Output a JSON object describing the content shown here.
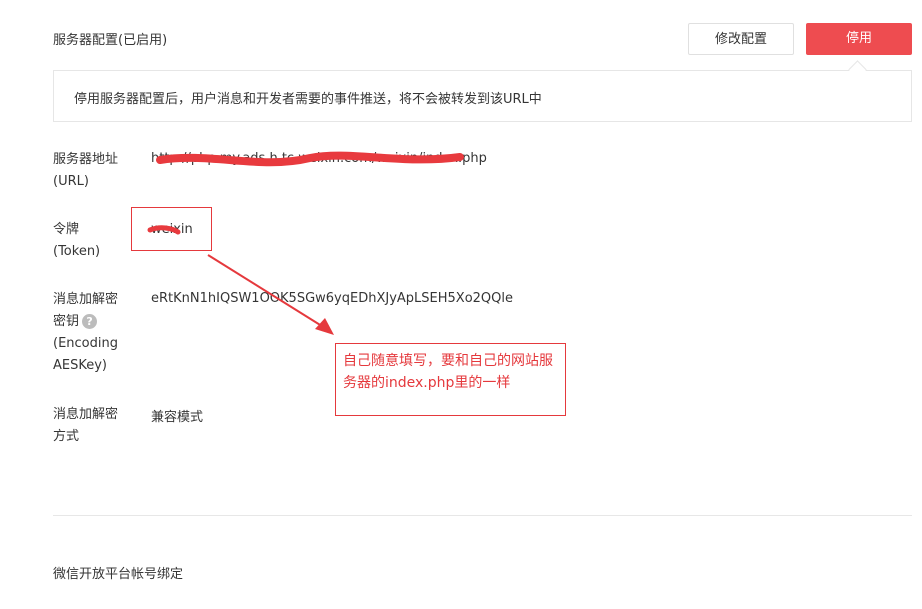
{
  "header": {
    "title": "服务器配置(已启用)",
    "edit_button": "修改配置",
    "disable_button": "停用"
  },
  "tip": {
    "text": "停用服务器配置后，用户消息和开发者需要的事件推送，将不会被转发到该URL中"
  },
  "fields": {
    "url": {
      "label_line1": "服务器地址",
      "label_line2": "(URL)",
      "value": "http://php.my.ads.h.tc.weixin.com/weixin/index.php"
    },
    "token": {
      "label_line1": "令牌",
      "label_line2": "(Token)",
      "value": "weixin"
    },
    "aeskey": {
      "label_line1": "消息加解密",
      "label_line2": "密钥",
      "label_line3": "(Encoding",
      "label_line4": "AESKey)",
      "help": "?",
      "value": "eRtKnN1hIQSW1OOK5SGw6yqEDhXJyApLSEH5Xo2QQle"
    },
    "mode": {
      "label_line1": "消息加解密",
      "label_line2": "方式",
      "value": "兼容模式"
    }
  },
  "annotation": {
    "note": "自己随意填写，要和自己的网站服务器的index.php里的一样",
    "color": "#e5393d"
  },
  "section": {
    "title": "微信开放平台帐号绑定"
  },
  "colors": {
    "primary": "#ee4c50",
    "annotation": "#e5393d",
    "text": "#353535"
  }
}
